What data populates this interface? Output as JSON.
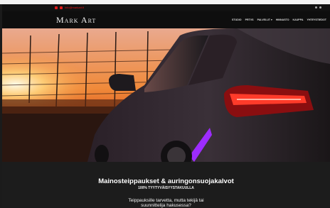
{
  "topbar": {
    "contact_text": "info@markart.fi",
    "accent_color": "#e01a1a"
  },
  "header": {
    "logo_text": "Mark Art",
    "nav": [
      "STUDIO",
      "PRTVS",
      "PALVELUT ▾",
      "HINNASTO",
      "KAUPPA",
      "YHTEYSTIEDOT"
    ]
  },
  "hero": {
    "description_icon": "car-photo"
  },
  "intro": {
    "headline": "Mainosteippaukset & auringonsuojakalvot",
    "subheadline": "100% TYYTYVÄISYYSTAKUULLA",
    "line1": "Teippauksille tarvetta, mutta tekijä tai",
    "line2": "suunnittelija hakusessa?"
  }
}
